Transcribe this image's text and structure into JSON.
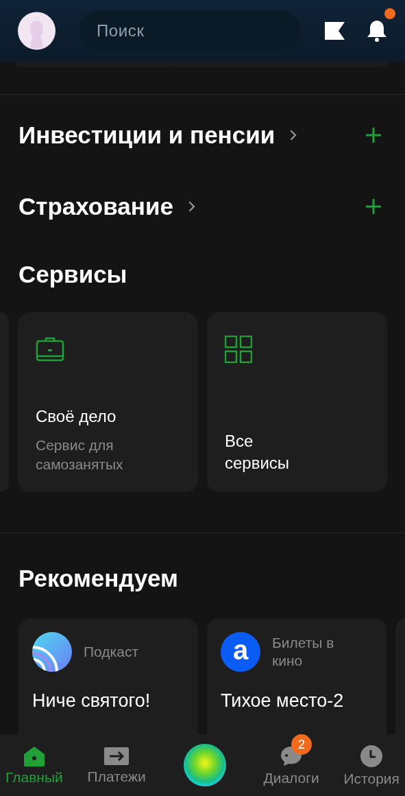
{
  "search": {
    "placeholder": "Поиск"
  },
  "notifications": {
    "unread": true
  },
  "sections": [
    {
      "title": "Инвестиции и пенсии",
      "kind": "expandable"
    },
    {
      "title": "Страхование",
      "kind": "expandable"
    }
  ],
  "services": {
    "title": "Сервисы",
    "items": [
      {
        "kind": "briefcase",
        "title": "Своё дело",
        "subtitle": "Сервис для самозанятых"
      },
      {
        "kind": "grid",
        "title": "Все сервисы"
      }
    ]
  },
  "recommended": {
    "title": "Рекомендуем",
    "items": [
      {
        "kind": "podcast",
        "category": "Подкаст",
        "title": "Ниче святого!"
      },
      {
        "kind": "letter",
        "logo_text": "a",
        "category": "Билеты в кино",
        "title": "Тихое место-2"
      }
    ]
  },
  "nav": [
    {
      "kind": "home",
      "label": "Главный",
      "selected": true
    },
    {
      "kind": "payments",
      "label": "Платежи",
      "selected": false
    },
    {
      "kind": "assistant"
    },
    {
      "kind": "chat",
      "label": "Диалоги",
      "selected": false,
      "badge": "2"
    },
    {
      "kind": "history",
      "label": "История",
      "selected": false
    }
  ]
}
